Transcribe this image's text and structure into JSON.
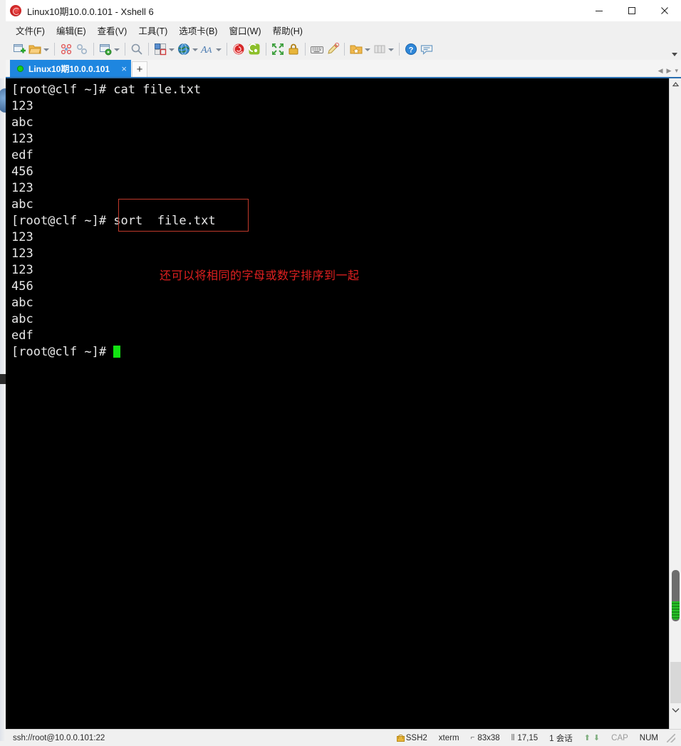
{
  "window": {
    "title": "Linux10期10.0.0.101 - Xshell 6",
    "app_icon": "rose-icon",
    "controls": {
      "minimize": "minimize-icon",
      "maximize": "maximize-icon",
      "close": "close-icon"
    }
  },
  "menu": {
    "items": [
      {
        "label": "文件(F)"
      },
      {
        "label": "编辑(E)"
      },
      {
        "label": "查看(V)"
      },
      {
        "label": "工具(T)"
      },
      {
        "label": "选项卡(B)"
      },
      {
        "label": "窗口(W)"
      },
      {
        "label": "帮助(H)"
      }
    ]
  },
  "toolbar": {
    "icons": [
      "new-session-icon",
      "open-folder-icon",
      "scissors-icon",
      "link-icon",
      "session-properties-icon",
      "find-icon",
      "layout-icon",
      "globe-icon",
      "font-icon",
      "xshell-icon",
      "xftp-icon",
      "fullscreen-icon",
      "lock-icon",
      "keyboard-icon",
      "highlight-pen-icon",
      "star-folder-icon",
      "columns-icon",
      "help-icon",
      "chat-icon"
    ]
  },
  "tabs": {
    "items": [
      {
        "label": "Linux10期10.0.0.101",
        "status_dot": "connected",
        "close_label": "×"
      }
    ],
    "add_label": "+",
    "nav_prev": "◀",
    "nav_next": "▶",
    "nav_menu": "▾"
  },
  "terminal": {
    "prompt_1": "[root@clf ~]# cat file.txt",
    "lines_1": [
      "123",
      "abc",
      "123",
      "edf",
      "456",
      "123",
      "abc"
    ],
    "prompt_2_head": "[root@clf ~]# ",
    "prompt_2_cmd": "sort  file.txt",
    "lines_2": [
      "123",
      "123",
      "123",
      "456",
      "abc",
      "abc",
      "edf"
    ],
    "prompt_3": "[root@clf ~]# ",
    "annotation": "还可以将相同的字母或数字排序到一起",
    "annotation_color": "#e02020",
    "highlight_box_color": "#c0392b",
    "fg_color": "#e8e8e8",
    "bg_color": "#000000",
    "cursor_color": "#12e312"
  },
  "statusbar": {
    "connection": "ssh://root@10.0.0.101:22",
    "protocol": "SSH2",
    "term_type": "xterm",
    "size": "83x38",
    "cursor_pos": "17,15",
    "sessions": "1 会话",
    "cap": "CAP",
    "num": "NUM"
  }
}
